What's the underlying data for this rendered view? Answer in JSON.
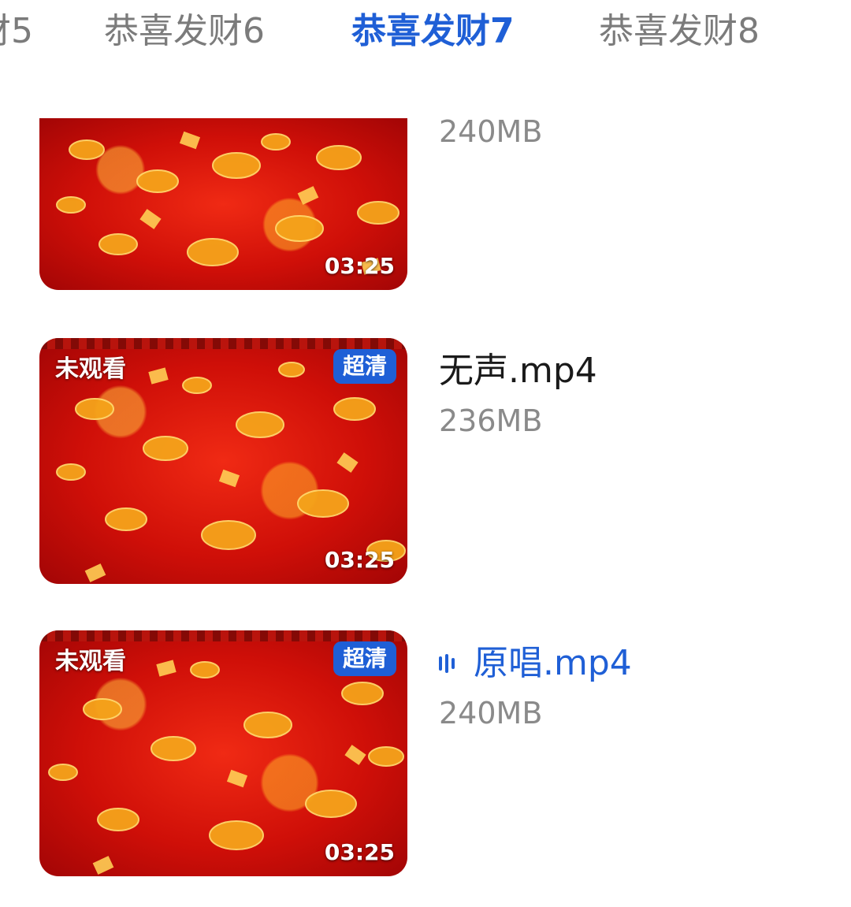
{
  "tabs": [
    {
      "label": "财5",
      "active": false
    },
    {
      "label": "恭喜发财6",
      "active": false
    },
    {
      "label": "恭喜发财7",
      "active": true
    },
    {
      "label": "恭喜发财8",
      "active": false
    }
  ],
  "videos": [
    {
      "filename": "",
      "size": "240MB",
      "duration": "03:25",
      "status": "",
      "quality": "",
      "playing": false
    },
    {
      "filename": "无声.mp4",
      "size": "236MB",
      "duration": "03:25",
      "status": "未观看",
      "quality": "超清",
      "playing": false
    },
    {
      "filename": "原唱.mp4",
      "size": "240MB",
      "duration": "03:25",
      "status": "未观看",
      "quality": "超清",
      "playing": true
    }
  ],
  "icons": {
    "now_playing": "audio-bars-icon"
  },
  "colors": {
    "accent": "#1f5fd6",
    "inactive_tab": "#7b7b7b",
    "secondary_text": "#8a8a8a",
    "thumbnail_red": "#cf0f08"
  }
}
